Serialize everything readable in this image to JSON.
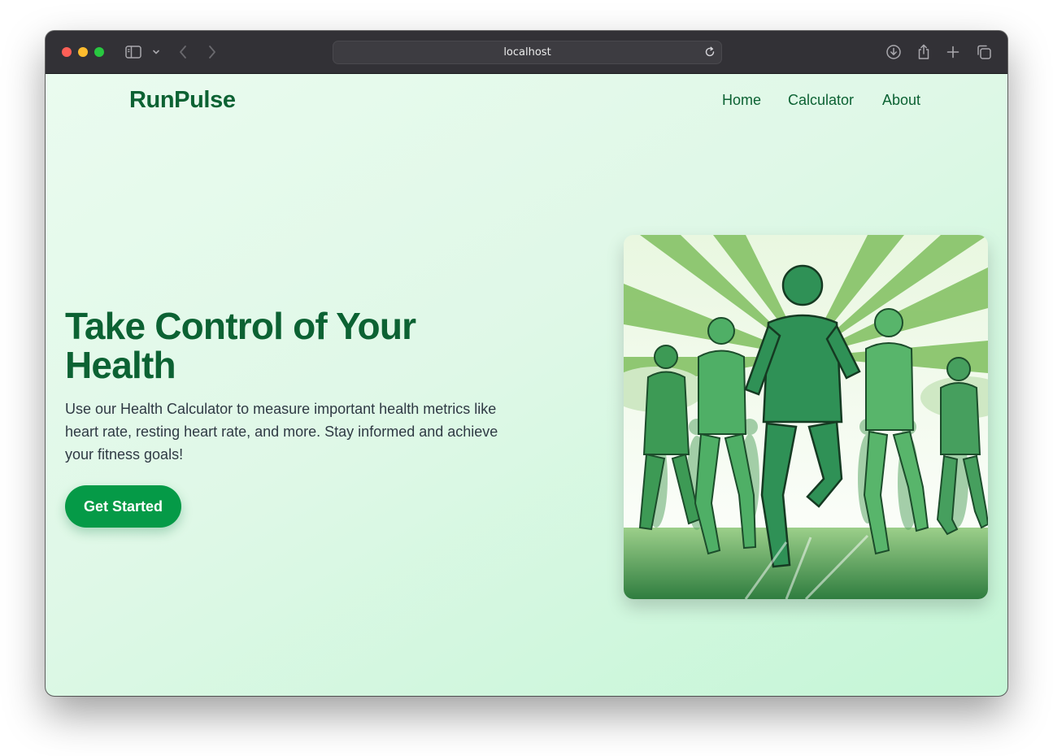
{
  "browser": {
    "url": "localhost",
    "icons": {
      "sidebar": "sidebar-icon",
      "chevron": "chevron-down-icon",
      "back": "back-icon",
      "forward": "forward-icon",
      "reload": "reload-icon",
      "download": "download-icon",
      "share": "share-icon",
      "new_tab": "plus-icon",
      "tabs": "tabs-overview-icon"
    }
  },
  "site": {
    "brand": "RunPulse",
    "nav": {
      "home": "Home",
      "calculator": "Calculator",
      "about": "About"
    }
  },
  "hero": {
    "title": "Take Control of Your Health",
    "description": "Use our Health Calculator to measure important health metrics like heart rate, resting heart rate, and more. Stay informed and achieve your fitness goals!",
    "cta_label": "Get Started",
    "image_subject": "illustration of a group of runners in green"
  },
  "colors": {
    "brand_green": "#0c6233",
    "button_green": "#059a47",
    "background_light": "#e6faee",
    "background_mint": "#c4f6d6"
  }
}
